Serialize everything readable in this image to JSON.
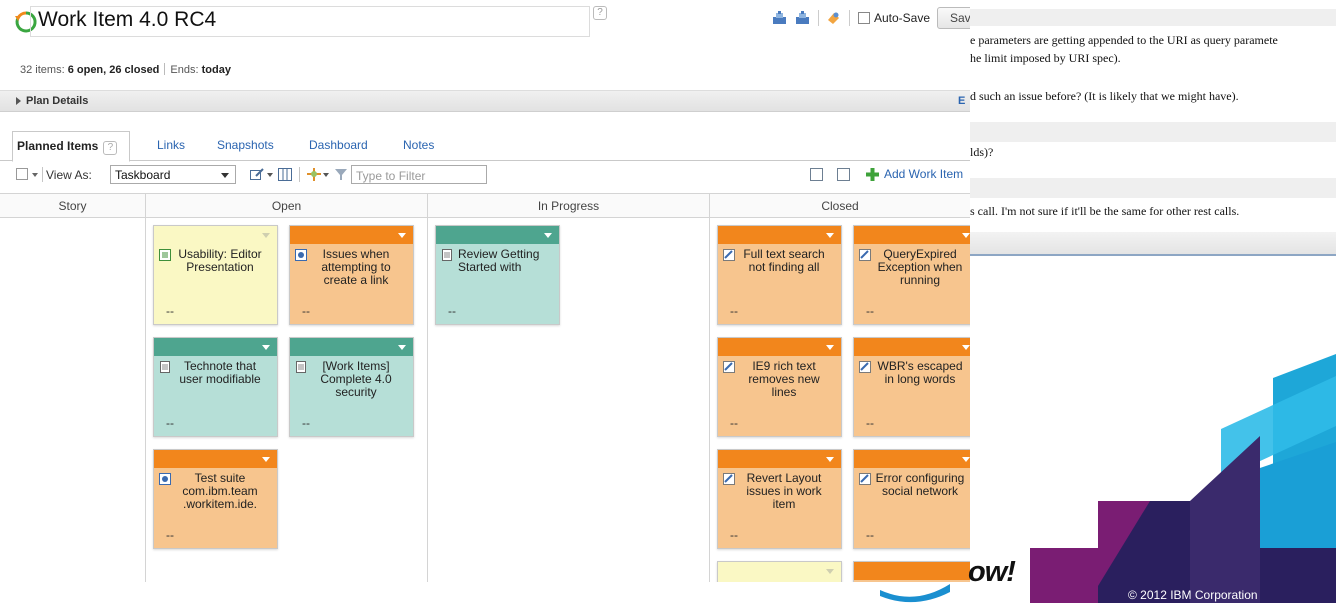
{
  "plan": {
    "title": "Work Item 4.0 RC4",
    "help_mark": "?",
    "summary": {
      "items_prefix": "32 items:",
      "open_closed": "6 open, 26 closed",
      "ends_label": "Ends:",
      "ends_value": "today"
    },
    "plan_details_label": "Plan Details",
    "plan_details_edit": "E",
    "toolbar": {
      "autosave_label": "Auto-Save",
      "save_label": "Save"
    },
    "tabs": [
      {
        "label": "Planned Items",
        "active": true
      },
      {
        "label": "Links"
      },
      {
        "label": "Snapshots"
      },
      {
        "label": "Dashboard"
      },
      {
        "label": "Notes"
      }
    ],
    "viewbar": {
      "view_as_label": "View As:",
      "view_as_value": "Taskboard",
      "filter_placeholder": "Type to Filter",
      "add_label": "Add Work Item"
    },
    "columns": [
      "Story",
      "Open",
      "In Progress",
      "Closed"
    ],
    "cards": [
      {
        "title": "Usability: Editor Presentation",
        "footer": "--",
        "color": "yellow",
        "icon": "story-icon"
      },
      {
        "title": "Issues when attempting to create a link",
        "footer": "--",
        "color": "orange",
        "icon": "defect-icon"
      },
      {
        "title": "Technote that user modifiable",
        "footer": "--",
        "color": "teal",
        "icon": "task-icon"
      },
      {
        "title": "[Work Items] Complete 4.0 security",
        "footer": "--",
        "color": "teal",
        "icon": "task-icon"
      },
      {
        "title": "Test suite com.ibm.team .workitem.ide.",
        "footer": "--",
        "color": "orange",
        "icon": "defect-icon"
      },
      {
        "title": "Review Getting Started with",
        "footer": "--",
        "color": "teal",
        "icon": "task-icon"
      },
      {
        "title": "Full text search not finding all",
        "footer": "--",
        "color": "orange",
        "icon": "resolved-defect-icon"
      },
      {
        "title": "QueryExpired Exception when running",
        "footer": "--",
        "color": "orange",
        "icon": "resolved-defect-icon"
      },
      {
        "title": "IE9 rich text removes new lines",
        "footer": "--",
        "color": "orange",
        "icon": "resolved-defect-icon"
      },
      {
        "title": "WBR's escaped in long words",
        "footer": "--",
        "color": "orange",
        "icon": "resolved-defect-icon"
      },
      {
        "title": "Revert Layout issues in work item",
        "footer": "--",
        "color": "orange",
        "icon": "resolved-defect-icon"
      },
      {
        "title": "Error configuring social network",
        "footer": "--",
        "color": "orange",
        "icon": "resolved-defect-icon"
      }
    ],
    "colors": {
      "orange_bar": "#f2861c",
      "orange_body": "#f7c58e",
      "teal_bar": "#4ea58f",
      "teal_body": "#b6dfd7",
      "yellow_body": "#faf8c4",
      "link_blue": "#2a64b0"
    }
  },
  "doc": {
    "lines": [
      "e parameters are getting appended to the URI as query paramete",
      "he limit imposed by URI spec).",
      "d such an issue before? (It is likely that we might have).",
      "lds)?",
      "s call. I'm not sure if it'll be the same for other rest calls."
    ]
  },
  "slide": {
    "shout": "ow!",
    "copyright": "© 2012 IBM Corporation"
  }
}
